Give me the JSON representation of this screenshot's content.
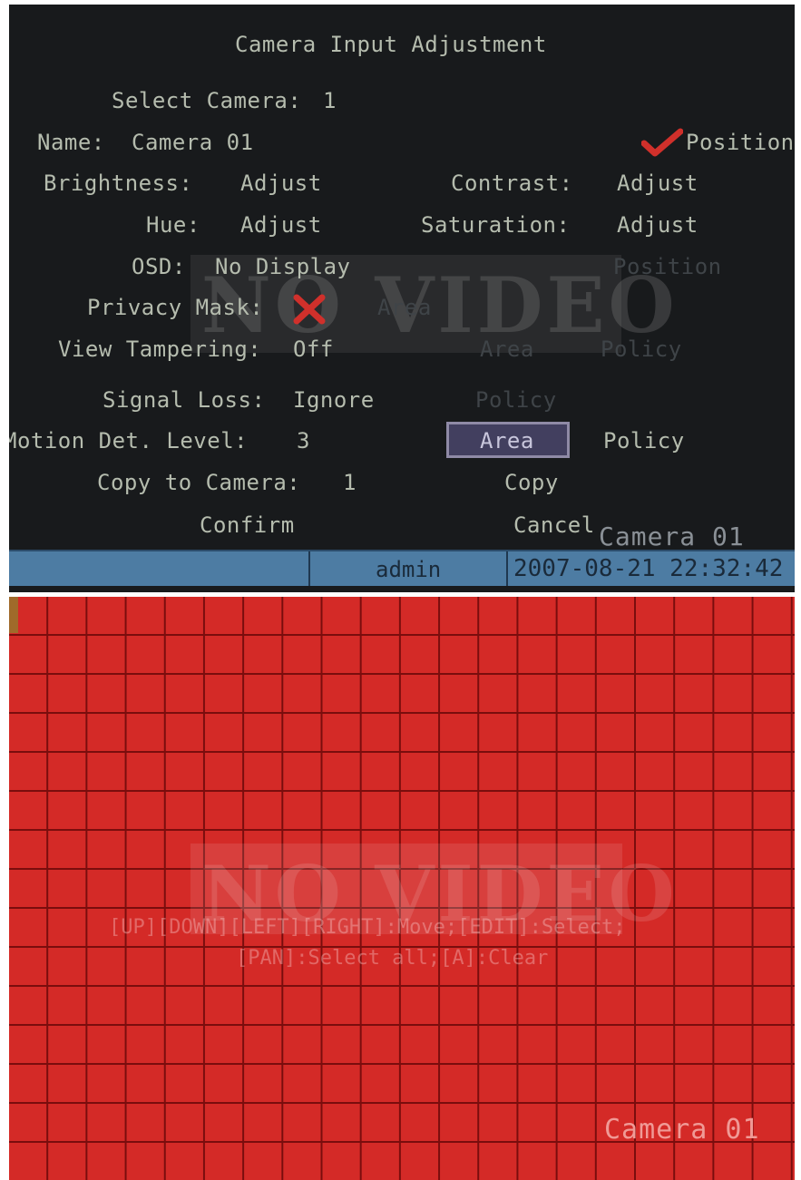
{
  "menu": {
    "title": "Camera Input Adjustment",
    "select_camera_label": "Select Camera:",
    "select_camera_value": "1",
    "name_label": "Name:",
    "name_value": "Camera 01",
    "name_position_label": "Position",
    "brightness_label": "Brightness:",
    "brightness_action": "Adjust",
    "contrast_label": "Contrast:",
    "contrast_action": "Adjust",
    "hue_label": "Hue:",
    "hue_action": "Adjust",
    "saturation_label": "Saturation:",
    "saturation_action": "Adjust",
    "osd_label": "OSD:",
    "osd_value": "No Display",
    "osd_position_label": "Position",
    "privacy_mask_label": "Privacy Mask:",
    "privacy_area_label": "Area",
    "view_tampering_label": "View Tampering:",
    "view_tampering_value": "Off",
    "view_tampering_area_label": "Area",
    "view_tampering_policy_label": "Policy",
    "signal_loss_label": "Signal Loss:",
    "signal_loss_value": "Ignore",
    "signal_loss_policy_label": "Policy",
    "motion_label": "Motion Det. Level:",
    "motion_value": "3",
    "motion_area_label": "Area",
    "motion_policy_label": "Policy",
    "copy_to_label": "Copy to Camera:",
    "copy_to_value": "1",
    "copy_label": "Copy",
    "confirm_label": "Confirm",
    "cancel_label": "Cancel"
  },
  "watermark": "NO VIDEO",
  "camera_name_overlay": "Camera 01",
  "status_bar": {
    "user": "admin",
    "datetime": "2007-08-21 22:32:42"
  },
  "area_editor": {
    "hint_line1": "[UP][DOWN][LEFT][RIGHT]:Move;[EDIT]:Select;",
    "hint_line2": "[PAN]:Select all;[A]:Clear",
    "camera_label": "Camera 01",
    "grid_color": "#d42a27"
  },
  "icons": {
    "name_position_enabled": "checkmark-icon",
    "privacy_mask_enabled": "x-mark-icon"
  },
  "colors": {
    "menu_bg": "#181a1c",
    "menu_text": "#b5bcae",
    "disabled_text": "#3f4448",
    "status_bar": "#4d7ca3",
    "check": "#d0302b",
    "grid_fill": "#d42a27"
  }
}
